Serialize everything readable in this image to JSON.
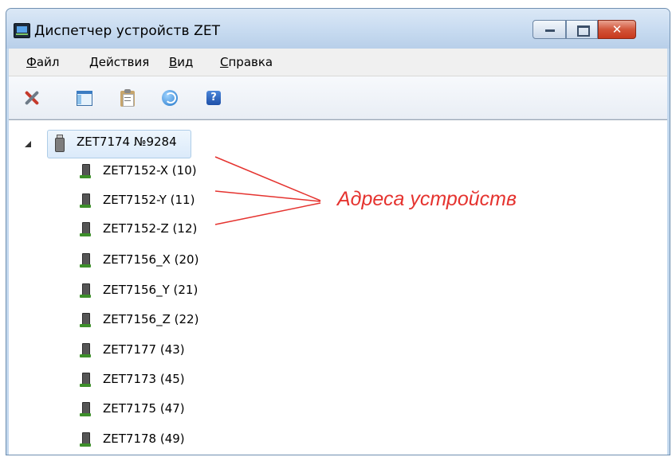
{
  "window": {
    "title": "Диспетчер устройств ZET",
    "controls": {
      "minimize": "minimize",
      "maximize": "maximize",
      "close": "✕"
    }
  },
  "menu": [
    {
      "accel": "Ф",
      "rest": "айл"
    },
    {
      "accel": "Д",
      "rest": "ействия"
    },
    {
      "accel": "В",
      "rest": "ид"
    },
    {
      "accel": "С",
      "rest": "правка"
    }
  ],
  "toolbar": {
    "icons": [
      "properties-icon",
      "window-icon",
      "clipboard-icon",
      "refresh-icon",
      "help-icon"
    ],
    "help_glyph": "?"
  },
  "tree": {
    "root": {
      "label": "ZET7174 №9284",
      "icon": "usb-device-icon",
      "expanded": true,
      "selected": true
    },
    "children": [
      {
        "label": "ZET7152-X (10)"
      },
      {
        "label": "ZET7152-Y (11)"
      },
      {
        "label": "ZET7152-Z (12)"
      },
      {
        "label": "ZET7156_X (20)"
      },
      {
        "label": "ZET7156_Y (21)"
      },
      {
        "label": "ZET7156_Z (22)"
      },
      {
        "label": "ZET7177 (43)"
      },
      {
        "label": "ZET7173 (45)"
      },
      {
        "label": "ZET7175 (47)"
      },
      {
        "label": "ZET7178 (49)"
      }
    ]
  },
  "annotation": {
    "text": "Адреса устройств",
    "color": "#e5332f"
  }
}
